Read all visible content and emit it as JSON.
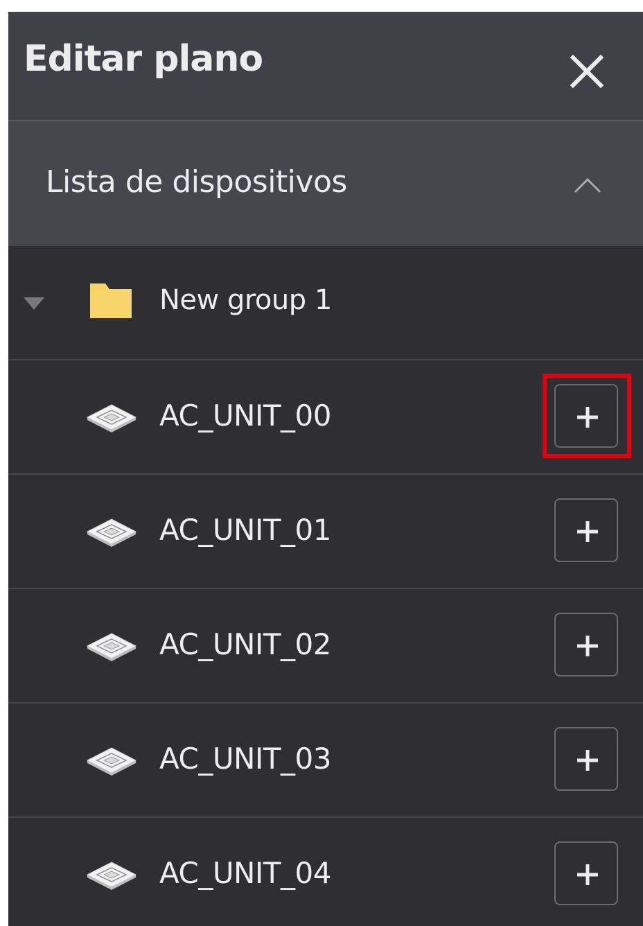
{
  "header": {
    "title": "Editar plano",
    "close_icon": "close-icon"
  },
  "device_list": {
    "title": "Lista de dispositivos",
    "collapse_icon": "chevron-up-icon",
    "group": {
      "label": "New group 1",
      "expand_icon": "caret-down-icon",
      "icon": "folder-icon"
    },
    "devices": [
      {
        "label": "AC_UNIT_00"
      },
      {
        "label": "AC_UNIT_01"
      },
      {
        "label": "AC_UNIT_02"
      },
      {
        "label": "AC_UNIT_03"
      },
      {
        "label": "AC_UNIT_04"
      }
    ],
    "device_icon": "ceiling-cassette-ac-icon",
    "add_icon": "plus-icon"
  },
  "colors": {
    "highlight": "#e3000f",
    "folder": "#f7d365",
    "panel_bg": "#2e2e33",
    "header_bg": "#404148",
    "section_bg": "#45464e"
  }
}
